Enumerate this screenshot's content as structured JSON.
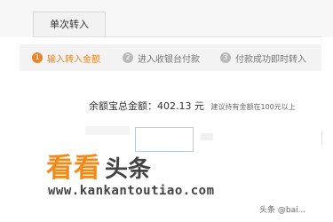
{
  "tab": {
    "label": "单次转入"
  },
  "steps": [
    {
      "num": "1",
      "label": "输入转入金额"
    },
    {
      "num": "2",
      "label": "进入收银台付款"
    },
    {
      "num": "3",
      "label": "付款成功即时转入"
    }
  ],
  "balance": {
    "label": "余额宝总金额：",
    "amount": "402.13 元",
    "tip": "建议持有金额在100元以上"
  },
  "amount_input": {
    "value": ""
  },
  "watermark": {
    "main": "看看",
    "sub": "头条",
    "url": "www.kankantoutiao.com"
  },
  "corner_text": "头条 @bai...",
  "colors": {
    "accent": "#e8852b",
    "watermark": "#f08a1c"
  }
}
